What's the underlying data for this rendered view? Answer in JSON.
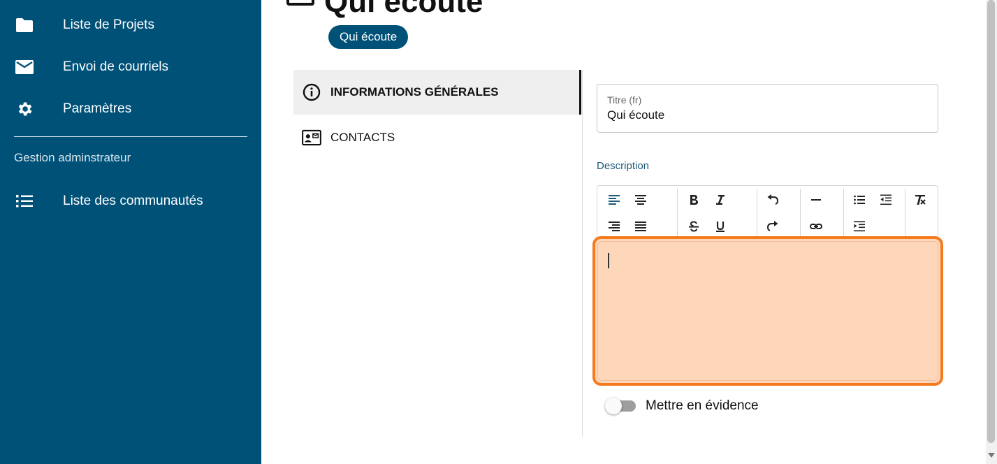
{
  "sidebar": {
    "items": [
      {
        "label": "Liste de Projets",
        "icon": "folder-icon"
      },
      {
        "label": "Envoi de courriels",
        "icon": "envelope-icon"
      },
      {
        "label": "Paramètres",
        "icon": "gear-icon"
      }
    ],
    "section_title": "Gestion adminstrateur",
    "admin_items": [
      {
        "label": "Liste des communautés",
        "icon": "list-icon"
      }
    ]
  },
  "header": {
    "title": "Qui écoute",
    "chip": "Qui écoute"
  },
  "tabs": [
    {
      "label": "INFORMATIONS GÉNÉRALES",
      "icon": "info-icon",
      "active": true
    },
    {
      "label": "CONTACTS",
      "icon": "contact-card-icon",
      "active": false
    }
  ],
  "form": {
    "title_label": "Titre (fr)",
    "title_value": "Qui écoute",
    "description_label": "Description",
    "toggle_label": "Mettre en évidence",
    "toggle_on": false
  },
  "colors": {
    "sidebar_bg": "#005178",
    "editor_highlight": "#f47b20",
    "editor_fill": "#fed6b9"
  }
}
